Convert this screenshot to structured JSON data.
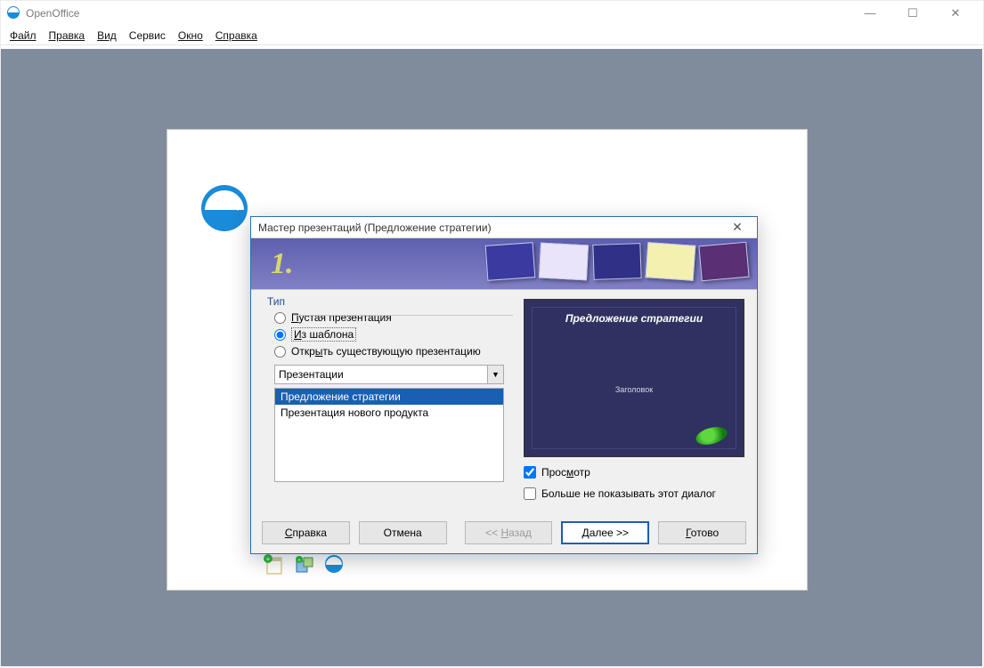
{
  "app": {
    "title": "OpenOffice"
  },
  "menu": {
    "file": "Файл",
    "edit": "Правка",
    "view": "Вид",
    "tools": "Сервис",
    "window": "Окно",
    "help": "Справка"
  },
  "wizard": {
    "title": "Мастер презентаций (Предложение стратегии)",
    "step_number": "1.",
    "group": {
      "legend": "Тип",
      "empty": "Пустая презентация",
      "from_template": "Из шаблона",
      "open_existing": "Открыть существующую презентацию"
    },
    "dropdown": {
      "selected": "Презентации"
    },
    "list": {
      "item0": "Предложение стратегии",
      "item1": "Презентация нового продукта"
    },
    "preview": {
      "title": "Предложение стратегии",
      "subtitle": "Заголовок"
    },
    "checks": {
      "preview": "Просмотр",
      "dont_show": "Больше не показывать этот диалог"
    },
    "buttons": {
      "help": "Справка",
      "cancel": "Отмена",
      "back": "<< Назад",
      "next": "Далее >>",
      "finish": "Готово"
    }
  }
}
